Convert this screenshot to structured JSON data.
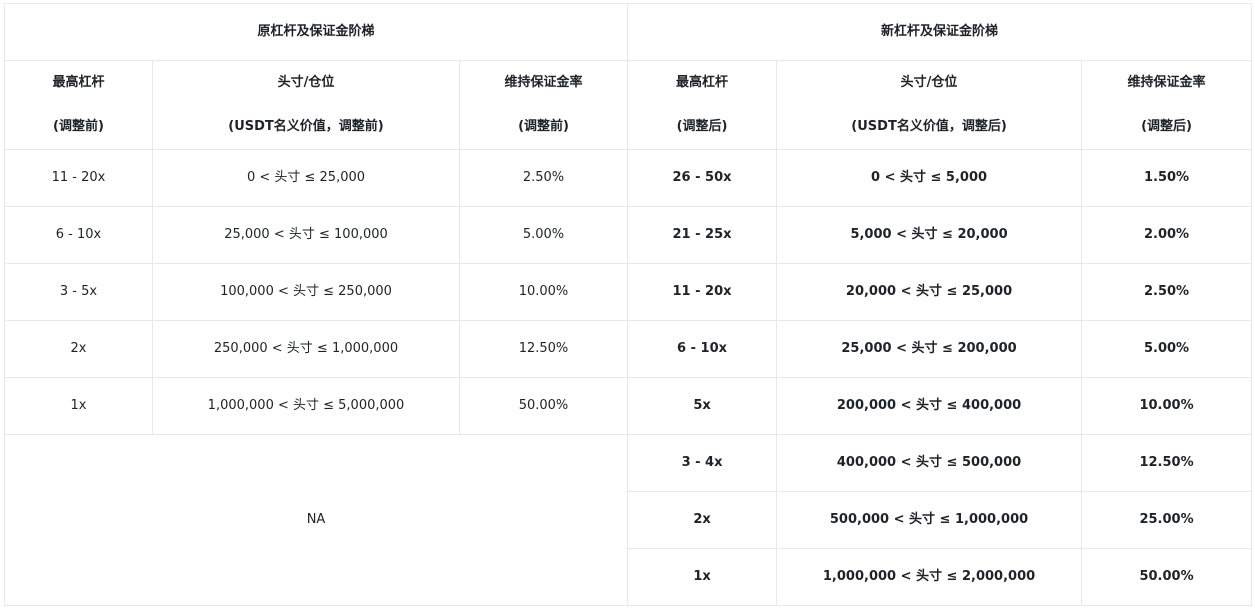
{
  "groups": {
    "old": "原杠杆及保证金阶梯",
    "new": "新杠杆及保证金阶梯"
  },
  "headers": {
    "old": {
      "leverage": [
        "最高杠杆",
        "(调整前)"
      ],
      "position": [
        "头寸/仓位",
        "(USDT名义价值，调整前)"
      ],
      "margin": [
        "维持保证金率",
        "(调整前)"
      ]
    },
    "new": {
      "leverage": [
        "最高杠杆",
        "(调整后)"
      ],
      "position": [
        "头寸/仓位",
        "(USDT名义价值，调整后)"
      ],
      "margin": [
        "维持保证金率",
        "(调整后)"
      ]
    }
  },
  "old_rows": [
    {
      "leverage": "11 - 20x",
      "position": "0 < 头寸 ≤ 25,000",
      "margin": "2.50%"
    },
    {
      "leverage": "6 - 10x",
      "position": "25,000 < 头寸 ≤ 100,000",
      "margin": "5.00%"
    },
    {
      "leverage": "3 - 5x",
      "position": "100,000 < 头寸 ≤ 250,000",
      "margin": "10.00%"
    },
    {
      "leverage": "2x",
      "position": "250,000 < 头寸 ≤ 1,000,000",
      "margin": "12.50%"
    },
    {
      "leverage": "1x",
      "position": "1,000,000 < 头寸 ≤ 5,000,000",
      "margin": "50.00%"
    }
  ],
  "old_na": "NA",
  "new_rows": [
    {
      "leverage": "26 - 50x",
      "position": "0 < 头寸 ≤ 5,000",
      "margin": "1.50%"
    },
    {
      "leverage": "21 - 25x",
      "position": "5,000 < 头寸 ≤ 20,000",
      "margin": "2.00%"
    },
    {
      "leverage": "11 - 20x",
      "position": "20,000 < 头寸 ≤ 25,000",
      "margin": "2.50%"
    },
    {
      "leverage": "6 - 10x",
      "position": "25,000 < 头寸 ≤ 200,000",
      "margin": "5.00%"
    },
    {
      "leverage": "5x",
      "position": "200,000 < 头寸 ≤ 400,000",
      "margin": "10.00%"
    },
    {
      "leverage": "3 - 4x",
      "position": "400,000 < 头寸 ≤ 500,000",
      "margin": "12.50%"
    },
    {
      "leverage": "2x",
      "position": "500,000 < 头寸 ≤ 1,000,000",
      "margin": "25.00%"
    },
    {
      "leverage": "1x",
      "position": "1,000,000 < 头寸 ≤ 2,000,000",
      "margin": "50.00%"
    }
  ]
}
